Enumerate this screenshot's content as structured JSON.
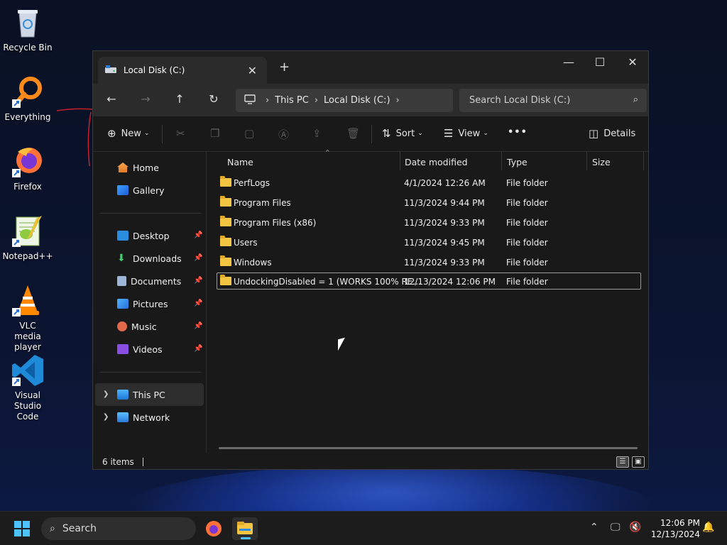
{
  "desktop": {
    "icons": [
      {
        "label": "Recycle Bin"
      },
      {
        "label": "Everything"
      },
      {
        "label": "Firefox"
      },
      {
        "label": "Notepad++"
      },
      {
        "label": "VLC media player"
      },
      {
        "label": "Visual Studio Code"
      }
    ]
  },
  "window": {
    "tab_title": "Local Disk (C:)",
    "new_tab": "+",
    "address": {
      "segments": [
        "This PC",
        "Local Disk (C:)"
      ]
    },
    "search_placeholder": "Search Local Disk (C:)",
    "commands": {
      "new": "New",
      "sort": "Sort",
      "view": "View",
      "more": "•••",
      "details": "Details"
    },
    "nav": {
      "home": "Home",
      "gallery": "Gallery",
      "quick": [
        "Desktop",
        "Downloads",
        "Documents",
        "Pictures",
        "Music",
        "Videos"
      ],
      "this_pc": "This PC",
      "network": "Network"
    },
    "columns": {
      "name": "Name",
      "date": "Date modified",
      "type": "Type",
      "size": "Size"
    },
    "files": [
      {
        "name": "PerfLogs",
        "date": "4/1/2024 12:26 AM",
        "type": "File folder"
      },
      {
        "name": "Program Files",
        "date": "11/3/2024 9:44 PM",
        "type": "File folder"
      },
      {
        "name": "Program Files (x86)",
        "date": "11/3/2024 9:33 PM",
        "type": "File folder"
      },
      {
        "name": "Users",
        "date": "11/3/2024 9:45 PM",
        "type": "File folder"
      },
      {
        "name": "Windows",
        "date": "11/3/2024 9:33 PM",
        "type": "File folder"
      },
      {
        "name": "UndockingDisabled = 1 (WORKS 100% RE...",
        "date": "12/13/2024 12:06 PM",
        "type": "File folder"
      }
    ],
    "status": "6 items"
  },
  "taskbar": {
    "search": "Search",
    "time": "12:06 PM",
    "date": "12/13/2024"
  },
  "colors": {
    "accent": "#4cc2ff",
    "folder": "#f4c542",
    "window_bg": "#191919"
  }
}
